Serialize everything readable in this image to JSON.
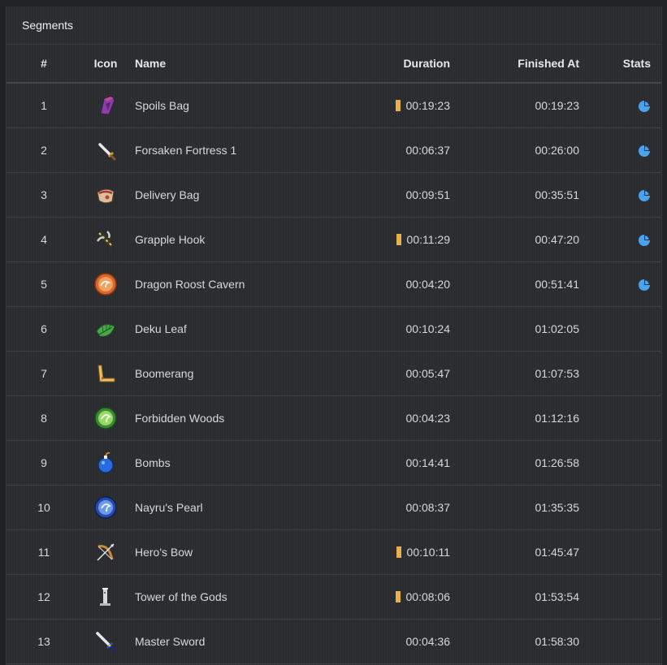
{
  "panel": {
    "title": "Segments"
  },
  "columns": {
    "num": "#",
    "icon": "Icon",
    "name": "Name",
    "duration": "Duration",
    "finished": "Finished At",
    "stats": "Stats"
  },
  "colors": {
    "gold_mark": "#e8b04a",
    "stats_blue": "#4aa3ee"
  },
  "segments": [
    {
      "num": "1",
      "icon": "spoils-bag-icon",
      "name": "Spoils Bag",
      "duration": "00:19:23",
      "finished": "00:19:23",
      "gold": true,
      "stats": true
    },
    {
      "num": "2",
      "icon": "sword-icon",
      "name": "Forsaken Fortress 1",
      "duration": "00:06:37",
      "finished": "00:26:00",
      "gold": false,
      "stats": true
    },
    {
      "num": "3",
      "icon": "delivery-bag-icon",
      "name": "Delivery Bag",
      "duration": "00:09:51",
      "finished": "00:35:51",
      "gold": false,
      "stats": true
    },
    {
      "num": "4",
      "icon": "grapple-hook-icon",
      "name": "Grapple Hook",
      "duration": "00:11:29",
      "finished": "00:47:20",
      "gold": true,
      "stats": true
    },
    {
      "num": "5",
      "icon": "dragon-pearl-icon",
      "name": "Dragon Roost Cavern",
      "duration": "00:04:20",
      "finished": "00:51:41",
      "gold": false,
      "stats": true
    },
    {
      "num": "6",
      "icon": "deku-leaf-icon",
      "name": "Deku Leaf",
      "duration": "00:10:24",
      "finished": "01:02:05",
      "gold": false,
      "stats": false
    },
    {
      "num": "7",
      "icon": "boomerang-icon",
      "name": "Boomerang",
      "duration": "00:05:47",
      "finished": "01:07:53",
      "gold": false,
      "stats": false
    },
    {
      "num": "8",
      "icon": "forest-pearl-icon",
      "name": "Forbidden Woods",
      "duration": "00:04:23",
      "finished": "01:12:16",
      "gold": false,
      "stats": false
    },
    {
      "num": "9",
      "icon": "bomb-icon",
      "name": "Bombs",
      "duration": "00:14:41",
      "finished": "01:26:58",
      "gold": false,
      "stats": false
    },
    {
      "num": "10",
      "icon": "nayru-pearl-icon",
      "name": "Nayru's Pearl",
      "duration": "00:08:37",
      "finished": "01:35:35",
      "gold": false,
      "stats": false
    },
    {
      "num": "11",
      "icon": "bow-icon",
      "name": "Hero's Bow",
      "duration": "00:10:11",
      "finished": "01:45:47",
      "gold": true,
      "stats": false
    },
    {
      "num": "12",
      "icon": "tower-icon",
      "name": "Tower of the Gods",
      "duration": "00:08:06",
      "finished": "01:53:54",
      "gold": true,
      "stats": false
    },
    {
      "num": "13",
      "icon": "master-sword-icon",
      "name": "Master Sword",
      "duration": "00:04:36",
      "finished": "01:58:30",
      "gold": false,
      "stats": false
    }
  ]
}
